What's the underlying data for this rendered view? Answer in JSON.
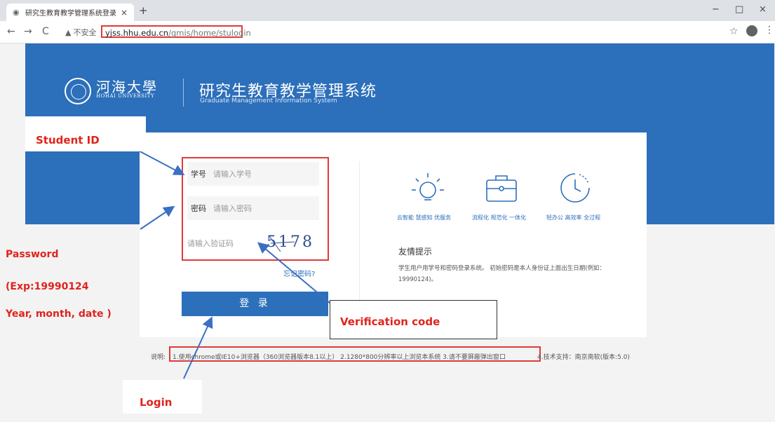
{
  "browser": {
    "tab_title": "研究生教育教学管理系统登录",
    "tab_close": "×",
    "new_tab": "+",
    "back": "←",
    "forward": "→",
    "reload": "C",
    "insecure_label": "不安全",
    "url_host": "yjss.hhu.edu.cn",
    "url_path": "/gmis/home/stulogin",
    "star": "☆",
    "menu": "⋮",
    "min": "−",
    "max": "□",
    "close": "×"
  },
  "header": {
    "university_cn": "河海大學",
    "university_en": "HOHAI UNIVERSITY",
    "system_cn": "研究生教育教学管理系统",
    "system_en": "Graduate Management Information System"
  },
  "login": {
    "student_id_label": "学号",
    "student_id_placeholder": "请输入学号",
    "password_label": "密码",
    "password_placeholder": "请输入密码",
    "captcha_placeholder": "请输入验证码",
    "captcha_text": "5178",
    "forgot_password": "忘记密码?",
    "login_button": "登 录"
  },
  "features": [
    {
      "icon": "lightbulb-icon",
      "label": "云智能 慧感知 优服务"
    },
    {
      "icon": "briefcase-icon",
      "label": "流程化 规范化 一体化"
    },
    {
      "icon": "clock-icon",
      "label": "轻办公 高效率 全过程"
    }
  ],
  "tips": {
    "title": "友情提示",
    "text": "学生用户用学号和密码登录系统。 初始密码是本人身份证上面出生日期(例如：19990124)。"
  },
  "footer": {
    "prefix": "说明:",
    "note": "1.使用chrome或IE10+浏览器（360浏览器版本8.1以上） 2.1280*800分辨率以上浏览本系统 3.请不要屏蔽弹出窗口",
    "tail": "4.技术支持：南京南软(版本:5.0)"
  },
  "annotations": {
    "student_id": "Student ID",
    "password": "Password",
    "password_example": "(Exp:19990124",
    "password_format": "Year, month, date )",
    "verification": "Verification code",
    "login": "Login"
  },
  "colors": {
    "brand_blue": "#2c6fba",
    "annotation_red": "#e0241c"
  }
}
